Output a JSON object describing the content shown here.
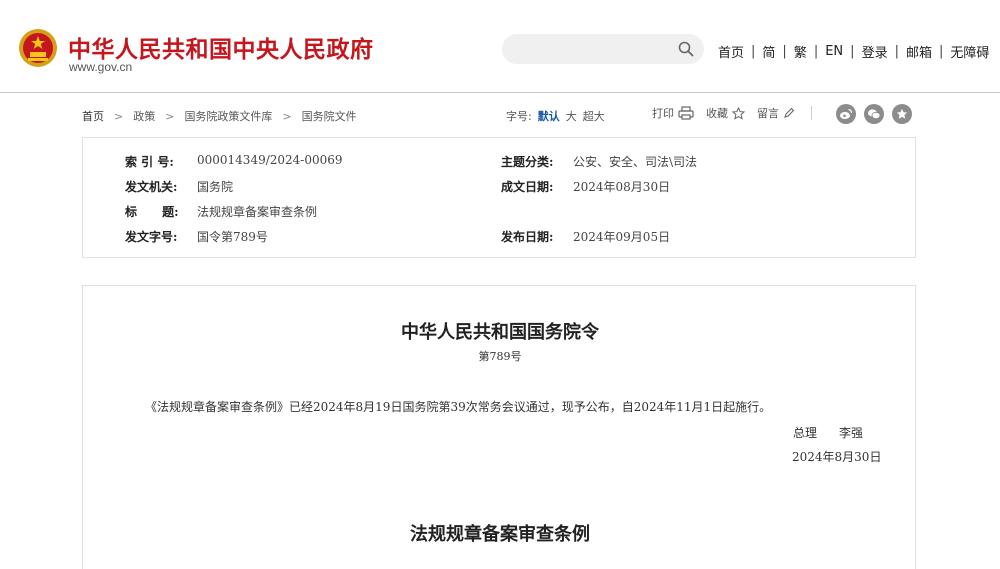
{
  "header": {
    "site_title": "中华人民共和国中央人民政府",
    "site_url": "www.gov.cn",
    "brand_color": "#c4161c",
    "search": {
      "placeholder": ""
    },
    "nav": [
      "首页",
      "简",
      "繁",
      "EN",
      "登录",
      "邮箱",
      "无障碍"
    ]
  },
  "breadcrumb": [
    "首页",
    "政策",
    "国务院政策文件库",
    "国务院文件"
  ],
  "toolbar": {
    "font_size_label": "字号:",
    "font_sizes": [
      "默认",
      "大",
      "超大"
    ],
    "active_font_size": "默认",
    "print_label": "打印",
    "collect_label": "收藏",
    "comment_label": "留言",
    "share_icons": [
      "weibo-icon",
      "wechat-icon",
      "favorite-star-icon"
    ]
  },
  "meta": {
    "index_label": "索  引  号:",
    "index_value": "000014349/2024-00069",
    "topic_label": "主题分类:",
    "topic_value": "公安、安全、司法\\司法",
    "issuer_label": "发文机关:",
    "issuer_value": "国务院",
    "written_date_label": "成文日期:",
    "written_date_value": "2024年08月30日",
    "title_label": "标      题:",
    "title_value": "法规规章备案审查条例",
    "doc_no_label": "发文字号:",
    "doc_no_value": "国令第789号",
    "publish_date_label": "发布日期:",
    "publish_date_value": "2024年09月05日"
  },
  "document": {
    "title": "中华人民共和国国务院令",
    "number": "第789号",
    "paragraph": "《法规规章备案审查条例》已经2024年8月19日国务院第39次常务会议通过，现予公布，自2024年11月1日起施行。",
    "sign_role": "总理",
    "sign_name": "李强",
    "sign_date": "2024年8月30日",
    "subtitle": "法规规章备案审查条例"
  }
}
